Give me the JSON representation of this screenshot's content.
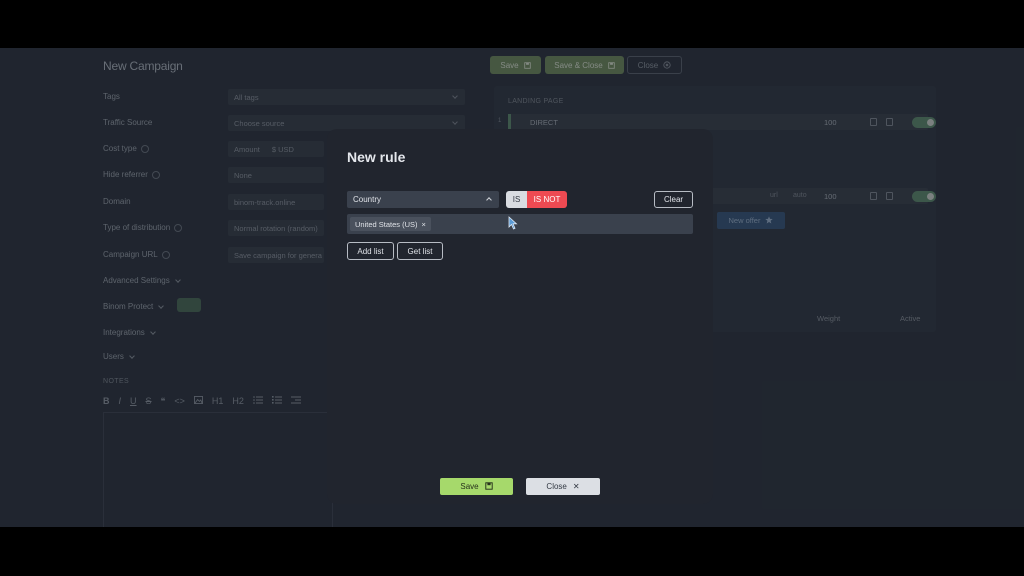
{
  "header": {
    "title": "New Campaign",
    "save_label": "Save",
    "save_close_label": "Save & Close",
    "close_label": "Close"
  },
  "form": {
    "tags_label": "Tags",
    "tags_value": "All tags",
    "traffic_source_label": "Traffic Source",
    "traffic_source_placeholder": "Choose source",
    "cost_type_label": "Cost type",
    "cost_amount_placeholder": "Amount",
    "cost_currency": "$ USD",
    "hide_referrer_label": "Hide referrer",
    "hide_referrer_value": "None",
    "domain_label": "Domain",
    "domain_value": "binom-track.online",
    "distribution_label": "Type of distribution",
    "distribution_value": "Normal rotation (random)",
    "campaign_url_label": "Campaign URL",
    "campaign_url_value": "Save campaign for genera",
    "advanced_settings_label": "Advanced Settings",
    "binom_protect_label": "Binom Protect",
    "integrations_label": "Integrations",
    "users_label": "Users",
    "notes_label": "NOTES",
    "toolbar_bold": "B",
    "toolbar_italic": "I",
    "toolbar_underline": "U",
    "toolbar_strike": "S",
    "toolbar_quote": "❝",
    "toolbar_code": "<>",
    "toolbar_h1": "H1",
    "toolbar_h2": "H2"
  },
  "landing": {
    "header": "LANDING PAGE",
    "row1_num": "1",
    "row1_name": "DIRECT",
    "row1_weight": "100",
    "row2_weight": "100",
    "row2_aux1": "url",
    "row2_aux2": "auto",
    "new_offer_label": "New offer",
    "col_weight": "Weight",
    "col_active": "Active"
  },
  "modal": {
    "title": "New rule",
    "condition_field": "Country",
    "is_label": "IS",
    "is_not_label": "IS NOT",
    "clear_label": "Clear",
    "selected_tags": [
      "United States (US)"
    ],
    "tag_remove": "×",
    "add_list_label": "Add list",
    "get_list_label": "Get list",
    "save_label": "Save",
    "close_label": "Close",
    "close_x": "✕"
  },
  "colors": {
    "is_not_active": "#ee4a52",
    "save_green": "#a6d96b",
    "modal_bg": "#21252e"
  }
}
